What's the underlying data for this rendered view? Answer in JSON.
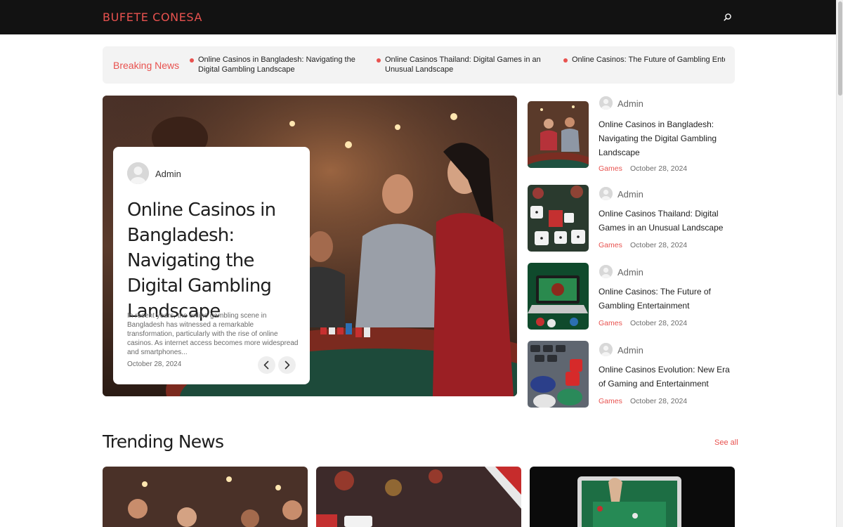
{
  "header": {
    "brand": "BUFETE CONESA",
    "search_icon": "search-icon"
  },
  "breaking": {
    "label": "Breaking News",
    "items": [
      "Online Casinos in Bangladesh: Navigating the Digital Gambling Landscape",
      "Online Casinos Thailand: Digital Games in an Unusual Landscape",
      "Online Casinos: The Future of Gambling Entertainment"
    ]
  },
  "hero": {
    "author": "Admin",
    "title": "Online Casinos in Bangladesh: Navigating the Digital Gambling Landscape",
    "excerpt": "In recent years, the online gambling scene in Bangladesh has witnessed a remarkable transformation, particularly with the rise of online casinos. As internet access becomes more widespread and smartphones...",
    "date": "October 28, 2024",
    "prev_icon": "chevron-left-icon",
    "next_icon": "chevron-right-icon"
  },
  "side_posts": [
    {
      "author": "Admin",
      "title": "Online Casinos in Bangladesh: Navigating the Digital Gambling Landscape",
      "category": "Games",
      "date": "October 28, 2024"
    },
    {
      "author": "Admin",
      "title": "Online Casinos Thailand: Digital Games in an Unusual Landscape",
      "category": "Games",
      "date": "October 28, 2024"
    },
    {
      "author": "Admin",
      "title": "Online Casinos: The Future of Gambling Entertainment",
      "category": "Games",
      "date": "October 28, 2024"
    },
    {
      "author": "Admin",
      "title": "Online Casinos Evolution: New Era of Gaming and Entertainment",
      "category": "Games",
      "date": "October 28, 2024"
    }
  ],
  "trending": {
    "title": "Trending News",
    "see_all": "See all"
  },
  "colors": {
    "accent": "#e8524f",
    "header_bg": "#121212",
    "breaking_bg": "#f3f3f3"
  }
}
